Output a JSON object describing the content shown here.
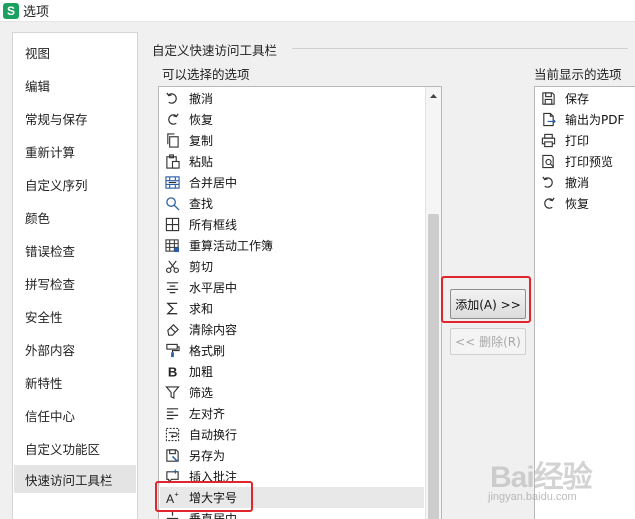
{
  "window": {
    "title": "选项",
    "logo_text": "S"
  },
  "sidebar": {
    "items": [
      {
        "label": "视图"
      },
      {
        "label": "编辑"
      },
      {
        "label": "常规与保存"
      },
      {
        "label": "重新计算"
      },
      {
        "label": "自定义序列"
      },
      {
        "label": "颜色"
      },
      {
        "label": "错误检查"
      },
      {
        "label": "拼写检查"
      },
      {
        "label": "安全性"
      },
      {
        "label": "外部内容"
      },
      {
        "label": "新特性"
      },
      {
        "label": "信任中心"
      },
      {
        "label": "自定义功能区"
      },
      {
        "label": "快速访问工具栏",
        "active": true
      }
    ]
  },
  "main": {
    "group_title": "自定义快速访问工具栏",
    "available_label": "可以选择的选项",
    "current_label": "当前显示的选项",
    "available_items": [
      {
        "label": "撤消",
        "icon": "undo-icon"
      },
      {
        "label": "恢复",
        "icon": "redo-icon"
      },
      {
        "label": "复制",
        "icon": "copy-icon"
      },
      {
        "label": "粘贴",
        "icon": "paste-icon"
      },
      {
        "label": "合并居中",
        "icon": "merge-center-icon"
      },
      {
        "label": "查找",
        "icon": "find-icon"
      },
      {
        "label": "所有框线",
        "icon": "all-borders-icon"
      },
      {
        "label": "重算活动工作簿",
        "icon": "recalculate-icon"
      },
      {
        "label": "剪切",
        "icon": "cut-icon"
      },
      {
        "label": "水平居中",
        "icon": "align-center-icon"
      },
      {
        "label": "求和",
        "icon": "sum-icon"
      },
      {
        "label": "清除内容",
        "icon": "clear-content-icon"
      },
      {
        "label": "格式刷",
        "icon": "format-painter-icon"
      },
      {
        "label": "加粗",
        "icon": "bold-icon"
      },
      {
        "label": "筛选",
        "icon": "filter-icon"
      },
      {
        "label": "左对齐",
        "icon": "align-left-icon"
      },
      {
        "label": "自动换行",
        "icon": "wrap-text-icon"
      },
      {
        "label": "另存为",
        "icon": "save-as-icon"
      },
      {
        "label": "插入批注",
        "icon": "insert-comment-icon"
      },
      {
        "label": "增大字号",
        "icon": "increase-font-icon",
        "selected": true
      },
      {
        "label": "垂直居中",
        "icon": "vertical-center-icon"
      }
    ],
    "current_items": [
      {
        "label": "保存",
        "icon": "save-icon"
      },
      {
        "label": "输出为PDF",
        "icon": "export-pdf-icon"
      },
      {
        "label": "打印",
        "icon": "print-icon"
      },
      {
        "label": "打印预览",
        "icon": "print-preview-icon"
      },
      {
        "label": "撤消",
        "icon": "undo-icon"
      },
      {
        "label": "恢复",
        "icon": "redo-icon"
      }
    ],
    "add_button": "添加(A) >>",
    "remove_button": "<< 删除(R)"
  },
  "watermark": {
    "main": "Bai经验",
    "sub": "jingyan.baidu.com"
  },
  "colors": {
    "highlight": "#e0262a",
    "logo": "#1aa15f",
    "selected_row": "#e8e8e8"
  }
}
